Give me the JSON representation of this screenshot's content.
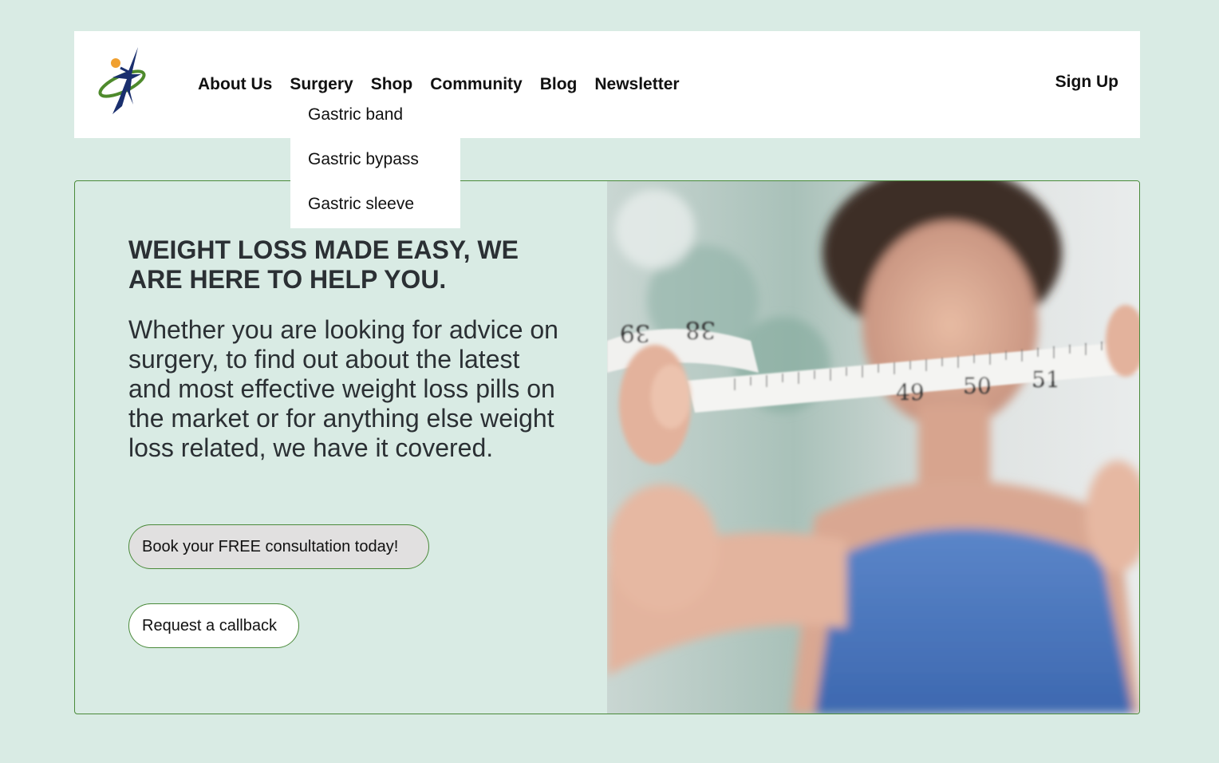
{
  "nav": {
    "items": [
      {
        "label": "About Us"
      },
      {
        "label": "Surgery"
      },
      {
        "label": "Shop"
      },
      {
        "label": "Community"
      },
      {
        "label": "Blog"
      },
      {
        "label": "Newsletter"
      }
    ],
    "signup_label": "Sign Up"
  },
  "surgery_menu": {
    "items": [
      {
        "label": "Gastric band"
      },
      {
        "label": "Gastric bypass"
      },
      {
        "label": "Gastric sleeve"
      }
    ]
  },
  "hero": {
    "title": "WEIGHT LOSS MADE EASY, WE ARE HERE TO HELP YOU.",
    "body": "Whether you are looking for advice on surgery, to find out about the latest and most effective weight loss pills on the market or for anything else weight loss related, we have it covered.",
    "primary_button": "Book your FREE consultation today!",
    "secondary_button": "Request a callback"
  },
  "photo": {
    "tape_numbers": [
      "39",
      "38",
      "49",
      "50",
      "51"
    ]
  },
  "colors": {
    "page_bg": "#d9ebe4",
    "accent_border": "#4a8a3a",
    "text_dark": "#2b3034"
  }
}
